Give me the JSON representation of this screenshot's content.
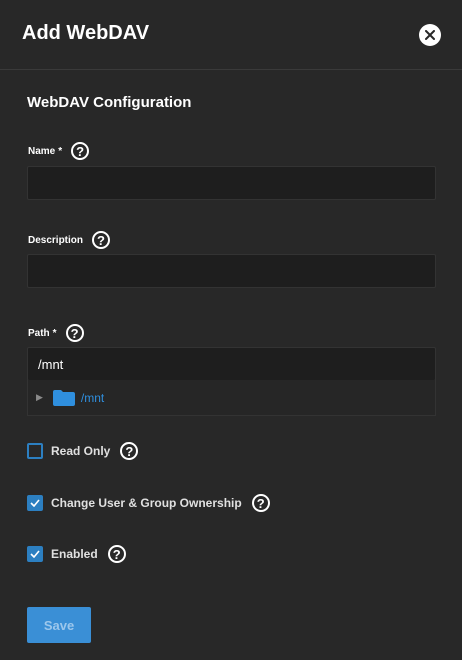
{
  "header": {
    "title": "Add WebDAV",
    "close_icon": "close-icon"
  },
  "section": {
    "title": "WebDAV Configuration"
  },
  "fields": {
    "name": {
      "label": "Name",
      "required": "*",
      "value": ""
    },
    "description": {
      "label": "Description",
      "value": ""
    },
    "path": {
      "label": "Path",
      "required": "*",
      "value": "/mnt"
    }
  },
  "tree": {
    "expander_icon": "chevron-right-icon",
    "folder_icon": "folder-icon",
    "folder_label": "/mnt"
  },
  "options": {
    "read_only": {
      "label": "Read Only",
      "checked": false
    },
    "change_ownership": {
      "label": "Change User & Group Ownership",
      "checked": true
    },
    "enabled": {
      "label": "Enabled",
      "checked": true
    }
  },
  "help_glyph": "?",
  "save": {
    "label": "Save"
  },
  "colors": {
    "background": "#282828",
    "input_bg": "#1e1e1e",
    "accent": "#2c7fc1",
    "link": "#2f8fde",
    "button": "#3a8fd6"
  }
}
